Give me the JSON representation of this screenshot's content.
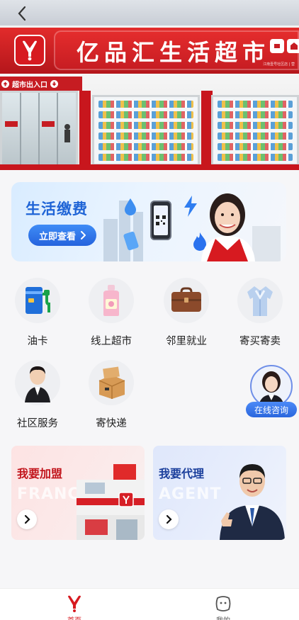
{
  "store": {
    "name": "亿品汇生活超市",
    "exit_label": "超市出入口",
    "address": "江南壹号社区店 | 营"
  },
  "banner": {
    "title": "生活缴费",
    "button_label": "立即查看"
  },
  "categories": [
    {
      "label": "油卡",
      "icon": "fuel-card-icon"
    },
    {
      "label": "线上超市",
      "icon": "detergent-bottle-icon"
    },
    {
      "label": "邻里就业",
      "icon": "briefcase-icon"
    },
    {
      "label": "寄买寄卖",
      "icon": "shirt-icon"
    },
    {
      "label": "社区服务",
      "icon": "service-staff-icon"
    },
    {
      "label": "寄快递",
      "icon": "parcel-box-icon"
    }
  ],
  "consult": {
    "label": "在线咨询"
  },
  "cards": {
    "join": {
      "title": "我要加盟",
      "watermark": "FRANCHISE"
    },
    "agent": {
      "title": "我要代理",
      "watermark": "AGENT"
    }
  },
  "tabbar": {
    "home": "首页",
    "mine": "我的"
  },
  "colors": {
    "brand_red": "#d71a20",
    "accent_blue": "#2a66dd"
  }
}
